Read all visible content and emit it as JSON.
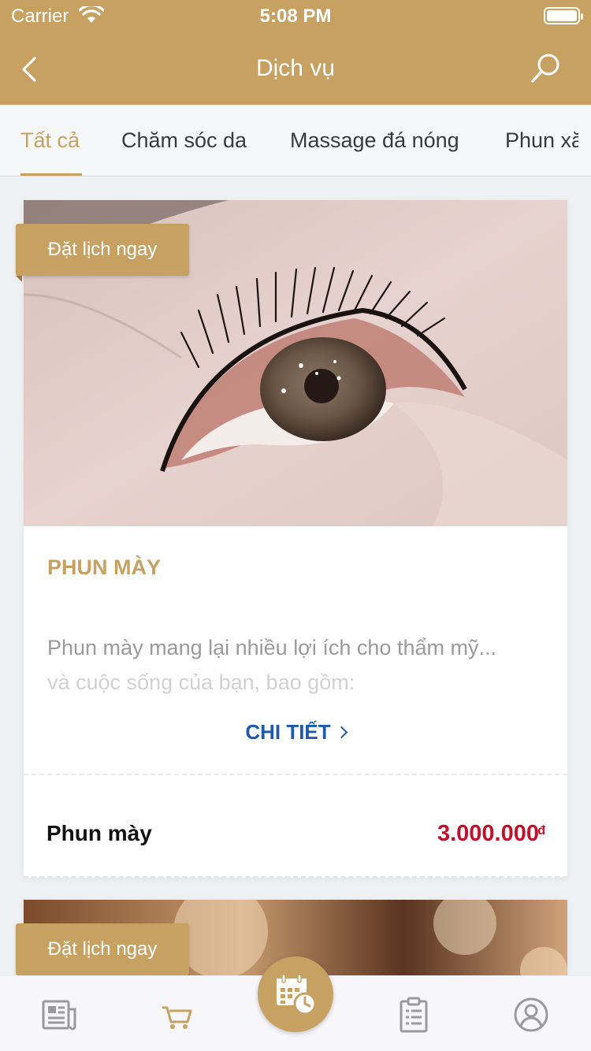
{
  "status_bar": {
    "carrier": "Carrier",
    "time": "5:08 PM"
  },
  "nav": {
    "title": "Dịch vụ",
    "back_icon": "chevron-left-icon",
    "search_icon": "search-icon"
  },
  "tabs": [
    {
      "label": "Tất cả",
      "active": true
    },
    {
      "label": "Chăm sóc da",
      "active": false
    },
    {
      "label": "Massage đá nóng",
      "active": false
    },
    {
      "label": "Phun xă",
      "active": false
    }
  ],
  "services": [
    {
      "book_label": "Đặt lịch ngay",
      "title": "PHUN MÀY",
      "description_line1": "Phun mày mang lại nhiều lợi ích cho thẩm mỹ...",
      "description_line2": "và cuộc sống của bạn, bao gồm:",
      "detail_label": "CHI TIẾT",
      "name": "Phun mày",
      "price": "3.000.000",
      "currency": "đ"
    },
    {
      "book_label": "Đặt lịch ngay"
    }
  ],
  "colors": {
    "brand": "#c6a162",
    "price": "#c0102b",
    "link": "#1e5aa8"
  },
  "tabbar": {
    "icons": [
      "news-icon",
      "cart-icon",
      "calendar-clock-icon",
      "clipboard-list-icon",
      "user-profile-icon"
    ]
  }
}
